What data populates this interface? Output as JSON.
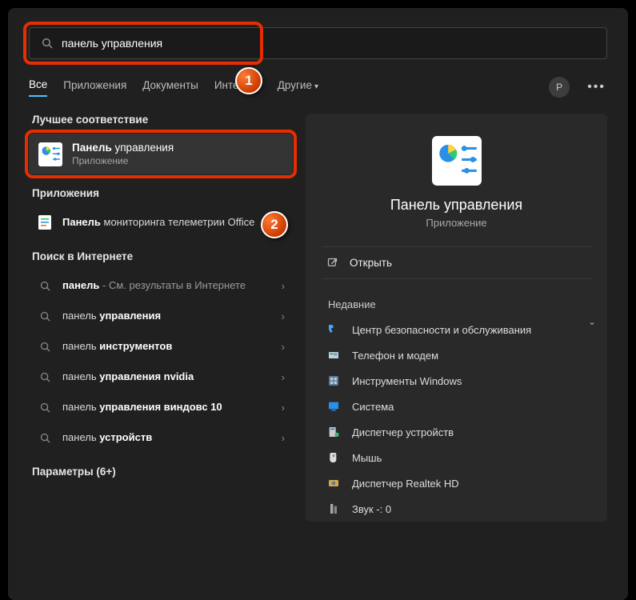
{
  "search": {
    "value": "панель управления"
  },
  "tabs": {
    "all": "Все",
    "apps": "Приложения",
    "docs": "Документы",
    "web": "Интернет",
    "more": "Другие"
  },
  "avatar_letter": "P",
  "left": {
    "best_match_head": "Лучшее соответствие",
    "best": {
      "title_bold": "Панель",
      "title_rest": " управления",
      "subtitle": "Приложение"
    },
    "apps_head": "Приложения",
    "apps": [
      {
        "bold": "Панель",
        "rest": " мониторинга телеметрии Office"
      }
    ],
    "web_head": "Поиск в Интернете",
    "web": [
      {
        "bold": "панель",
        "suffix": " - См. результаты в Интернете"
      },
      {
        "pre": "панель ",
        "bold": "управления"
      },
      {
        "pre": "панель ",
        "bold": "инструментов"
      },
      {
        "pre": "панель ",
        "bold": "управления nvidia"
      },
      {
        "pre": "панель ",
        "bold": "управления виндовс 10"
      },
      {
        "pre": "панель ",
        "bold": "устройств"
      }
    ],
    "params_head": "Параметры (6+)"
  },
  "right": {
    "title": "Панель управления",
    "subtitle": "Приложение",
    "open": "Открыть",
    "recent_head": "Недавние",
    "recent": [
      "Центр безопасности и обслуживания",
      "Телефон и модем",
      "Инструменты Windows",
      "Система",
      "Диспетчер устройств",
      "Мышь",
      "Диспетчер Realtek HD",
      "Звук -: 0"
    ]
  },
  "annot": {
    "one": "1",
    "two": "2"
  }
}
